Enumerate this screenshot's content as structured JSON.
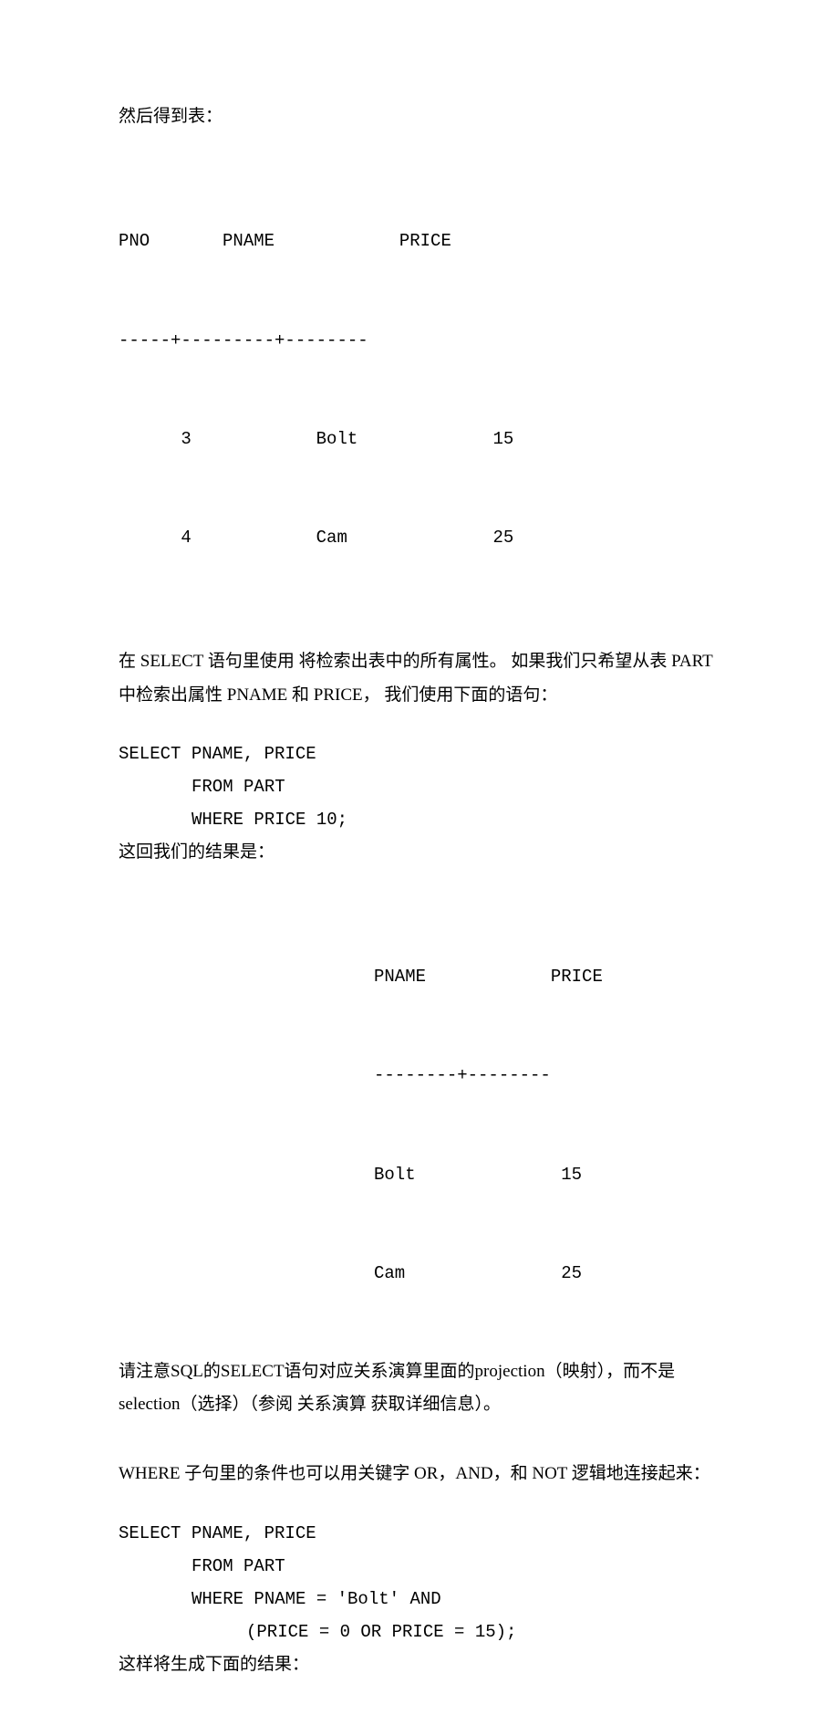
{
  "para1": "然后得到表：",
  "table1": {
    "header": "PNO       PNAME            PRICE",
    "divider": "-----+---------+--------",
    "row1": "      3            Bolt             15",
    "row2": "      4            Cam              25"
  },
  "para2": "在 SELECT 语句里使用  将检索出表中的所有属性。 如果我们只希望从表 PART 中检索出属性 PNAME 和 PRICE， 我们使用下面的语句：",
  "code1": {
    "l1": "SELECT PNAME, PRICE",
    "l2": "FROM PART",
    "l3": "WHERE PRICE  10;"
  },
  "para3": "这回我们的结果是：",
  "table2": {
    "header": "PNAME            PRICE",
    "divider": "--------+--------",
    "row1": "Bolt              15",
    "row2": "Cam               25"
  },
  "para4": "请注意SQL的SELECT语句对应关系演算里面的projection（映射），而不是 selection（选择）（参阅 关系演算 获取详细信息）。",
  "para5": "WHERE 子句里的条件也可以用关键字 OR，AND，和 NOT 逻辑地连接起来：",
  "code2": {
    "l1": "SELECT PNAME, PRICE",
    "l2": "FROM PART",
    "l3": "WHERE PNAME = 'Bolt' AND",
    "l4": "(PRICE = 0 OR PRICE = 15);"
  },
  "para6": "这样将生成下面的结果："
}
